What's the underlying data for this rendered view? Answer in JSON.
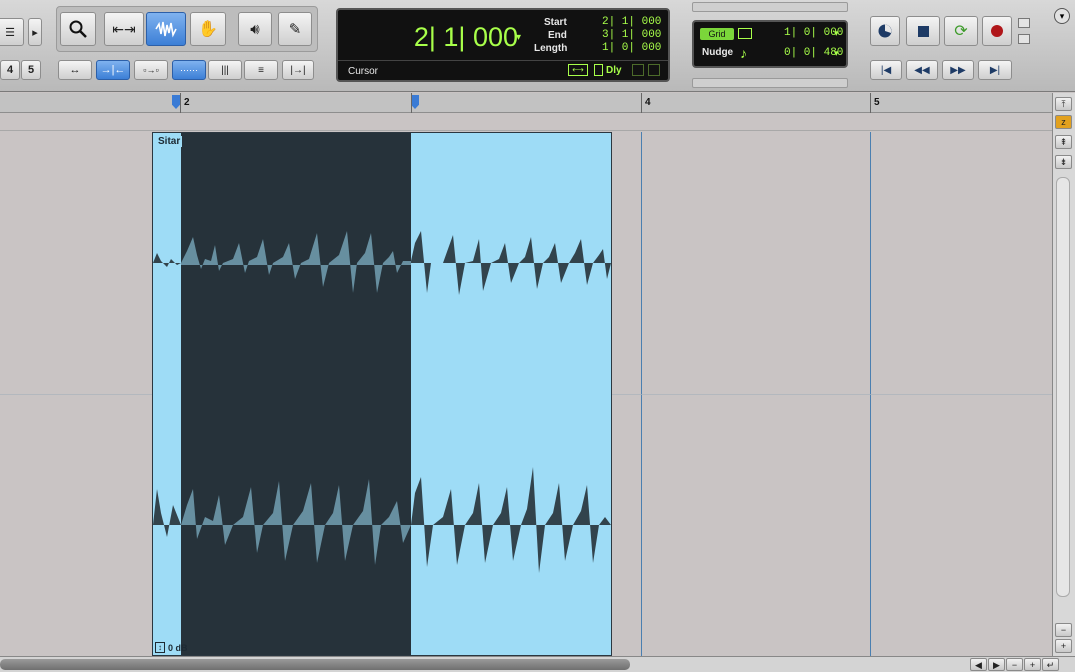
{
  "toolbar": {
    "zoom_presets": [
      "4",
      "5"
    ],
    "counter": {
      "main": "2| 1| 000",
      "cursor_label": "Cursor",
      "start_label": "Start",
      "end_label": "End",
      "length_label": "Length",
      "start": "2| 1| 000",
      "end": "3| 1| 000",
      "length": "1| 0| 000",
      "dly_label": "Dly"
    },
    "grid": {
      "grid_label": "Grid",
      "grid_value": "1| 0| 000",
      "nudge_label": "Nudge",
      "nudge_value": "0| 0| 480"
    }
  },
  "ruler": {
    "bars": [
      "2",
      "4",
      "5"
    ]
  },
  "track": {
    "clip_name": "Sitar",
    "clip_gain": "0 dB"
  },
  "colors": {
    "clip": "#9edcf6",
    "selection": "#26323a",
    "counter_text": "#a8ff4a"
  }
}
